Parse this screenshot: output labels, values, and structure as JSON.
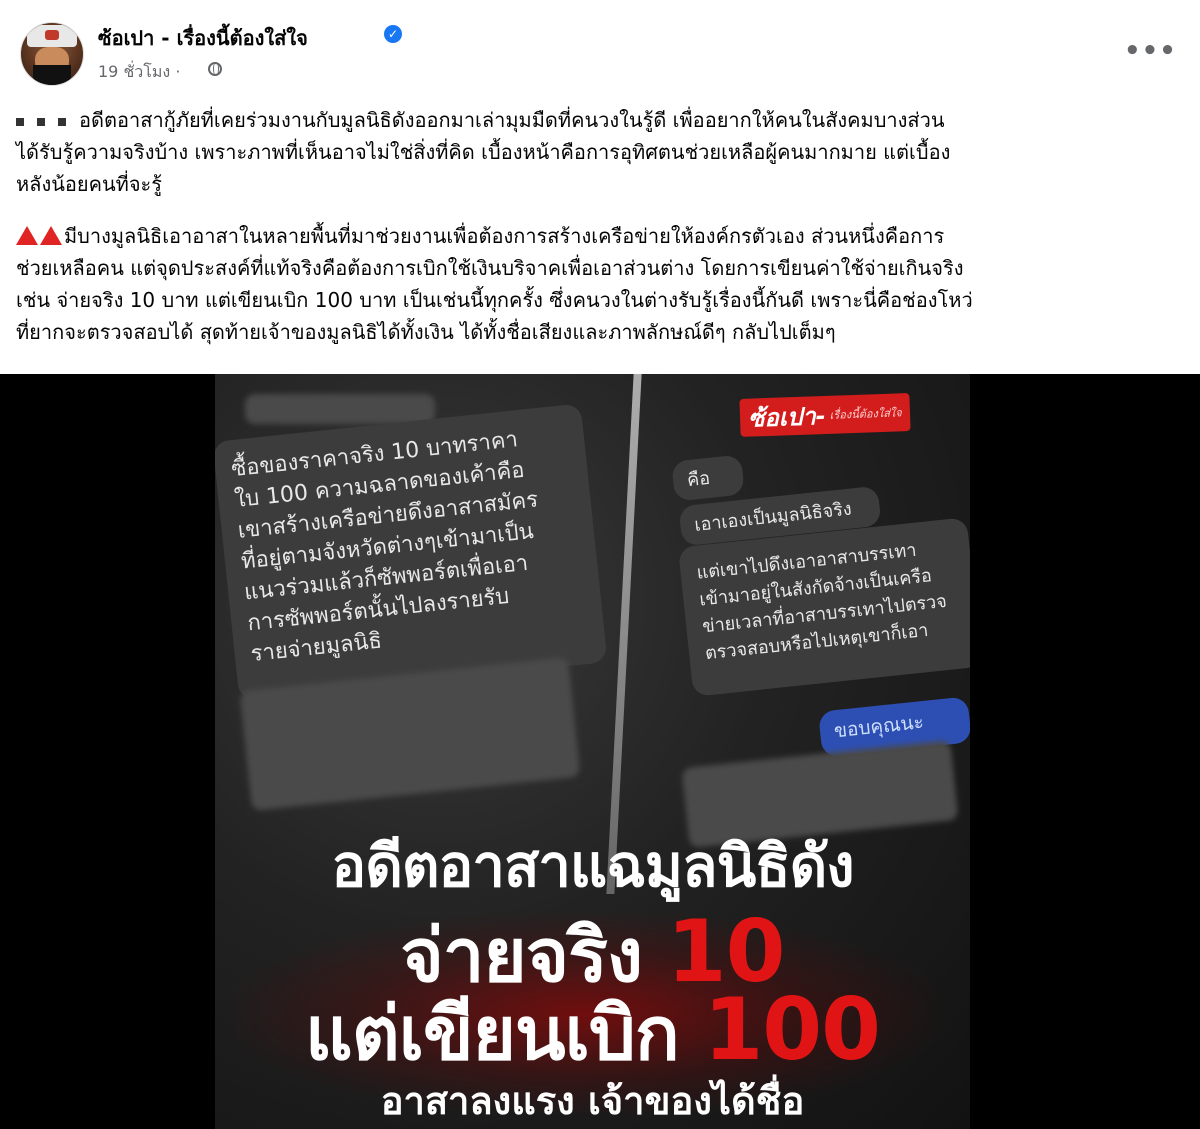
{
  "post": {
    "author": "ซ้อเปา - เรื่องนี้ต้องใส่ใจ",
    "time": "19 ชั่วโมง ·",
    "paragraph_1": "อดีตอาสากู้ภัยที่เคยร่วมงานกับมูลนิธิดังออกมาเล่ามุมมืดที่คนวงในรู้ดี เพื่ออยากให้คนในสังคมบางส่วน\nได้รับรู้ความจริงบ้าง เพราะภาพที่เห็นอาจไม่ใช่สิ่งที่คิด เบื้องหน้าคือการอุทิศตนช่วยเหลือผู้คนมากมาย แต่เบื้อง\nหลังน้อยคนที่จะรู้",
    "paragraph_2": "มีบางมูลนิธิเอาอาสาในหลายพื้นที่มาช่วยงานเพื่อต้องการสร้างเครือข่ายให้องค์กรตัวเอง ส่วนหนึ่งคือการ\nช่วยเหลือคน แต่จุดประสงค์ที่แท้จริงคือต้องการเบิกใช้เงินบริจาคเพื่อเอาส่วนต่าง โดยการเขียนค่าใช้จ่ายเกินจริง\nเช่น จ่ายจริง 10 บาท แต่เขียนเบิก 100 บาท เป็นเช่นนี้ทุกครั้ง ซึ่งคนวงในต่างรับรู้เรื่องนี้กันดี เพราะนี่คือช่องโหว่\nที่ยากจะตรวจสอบได้  สุดท้ายเจ้าของมูลนิธิได้ทั้งเงิน ได้ทั้งชื่อเสียงและภาพลักษณ์ดีๆ กลับไปเต็มๆ",
    "more_icon": "•••"
  },
  "image": {
    "brand": "ซ้อเปา-",
    "brand_sub": "เรื่องนี้ต้องใส่ใจ",
    "chat_left": "ซื้อของราคาจริง 10 บาทราคา\nใบ 100 ความฉลาดของเค้าคือ\nเขาสร้างเครือข่ายดึงอาสาสมัคร\nที่อยู่ตามจังหวัดต่างๆเข้ามาเป็น\nแนวร่วมแล้วก็ซัพพอร์ตเพื่อเอา\nการซัพพอร์ตนั้นไปลงรายรับ\nรายจ่ายมูลนิธิ",
    "chat_right_1": "คือ",
    "chat_right_2": "เอาเองเป็นมูลนิธิจริง",
    "chat_right_3": "แต่เขาไปดึงเอาอาสาบรรเทา\nเข้ามาอยู่ในสังกัดจ้างเป็นเครือ\nข่ายเวลาที่อาสาบรรเทาไปตรวจ\nตรวจสอบหรือไปเหตุเขาก็เอา",
    "chat_thanks": "ขอบคุณนะ",
    "headline_1": "อดีตอาสาแฉมูลนิธิดัง",
    "headline_2_text": "จ่ายจริง ",
    "headline_2_num": "10",
    "headline_3_text": "แต่เขียนเบิก ",
    "headline_3_num": "100",
    "headline_4": "อาสาลงแรง เจ้าของได้ชื่อ"
  }
}
